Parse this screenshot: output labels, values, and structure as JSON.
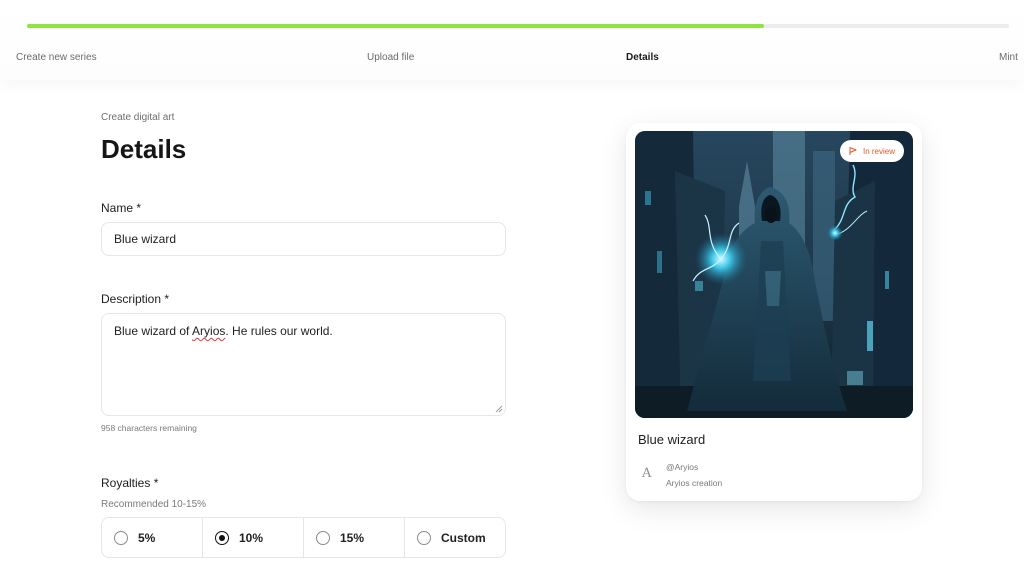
{
  "progress": {
    "percent": 75,
    "color": "#8ee53f",
    "steps": [
      {
        "label": "Create new series"
      },
      {
        "label": "Upload file"
      },
      {
        "label": "Details"
      },
      {
        "label": "Mint"
      }
    ],
    "active_step": "Details"
  },
  "form": {
    "eyebrow": "Create digital art",
    "title": "Details",
    "name_label": "Name *",
    "name_value": "Blue wizard",
    "description_label": "Description *",
    "description_prefix": "Blue wizard of ",
    "description_typo": "Aryios",
    "description_suffix": ". He rules our world.",
    "chars_remaining": "958 characters remaining",
    "royalties_label": "Royalties *",
    "royalties_hint": "Recommended 10-15%",
    "royalties_options": [
      {
        "label": "5%",
        "checked": false
      },
      {
        "label": "10%",
        "checked": true
      },
      {
        "label": "15%",
        "checked": false
      },
      {
        "label": "Custom",
        "checked": false
      }
    ]
  },
  "preview": {
    "badge": "In review",
    "badge_color": "#e4572e",
    "badge_icon": "flag-icon",
    "image_subject": "hooded blue wizard in a futuristic city",
    "title": "Blue wizard",
    "creator_logo": "A",
    "creator_handle": "@Aryios",
    "creator_subtitle": "Aryios creation"
  }
}
